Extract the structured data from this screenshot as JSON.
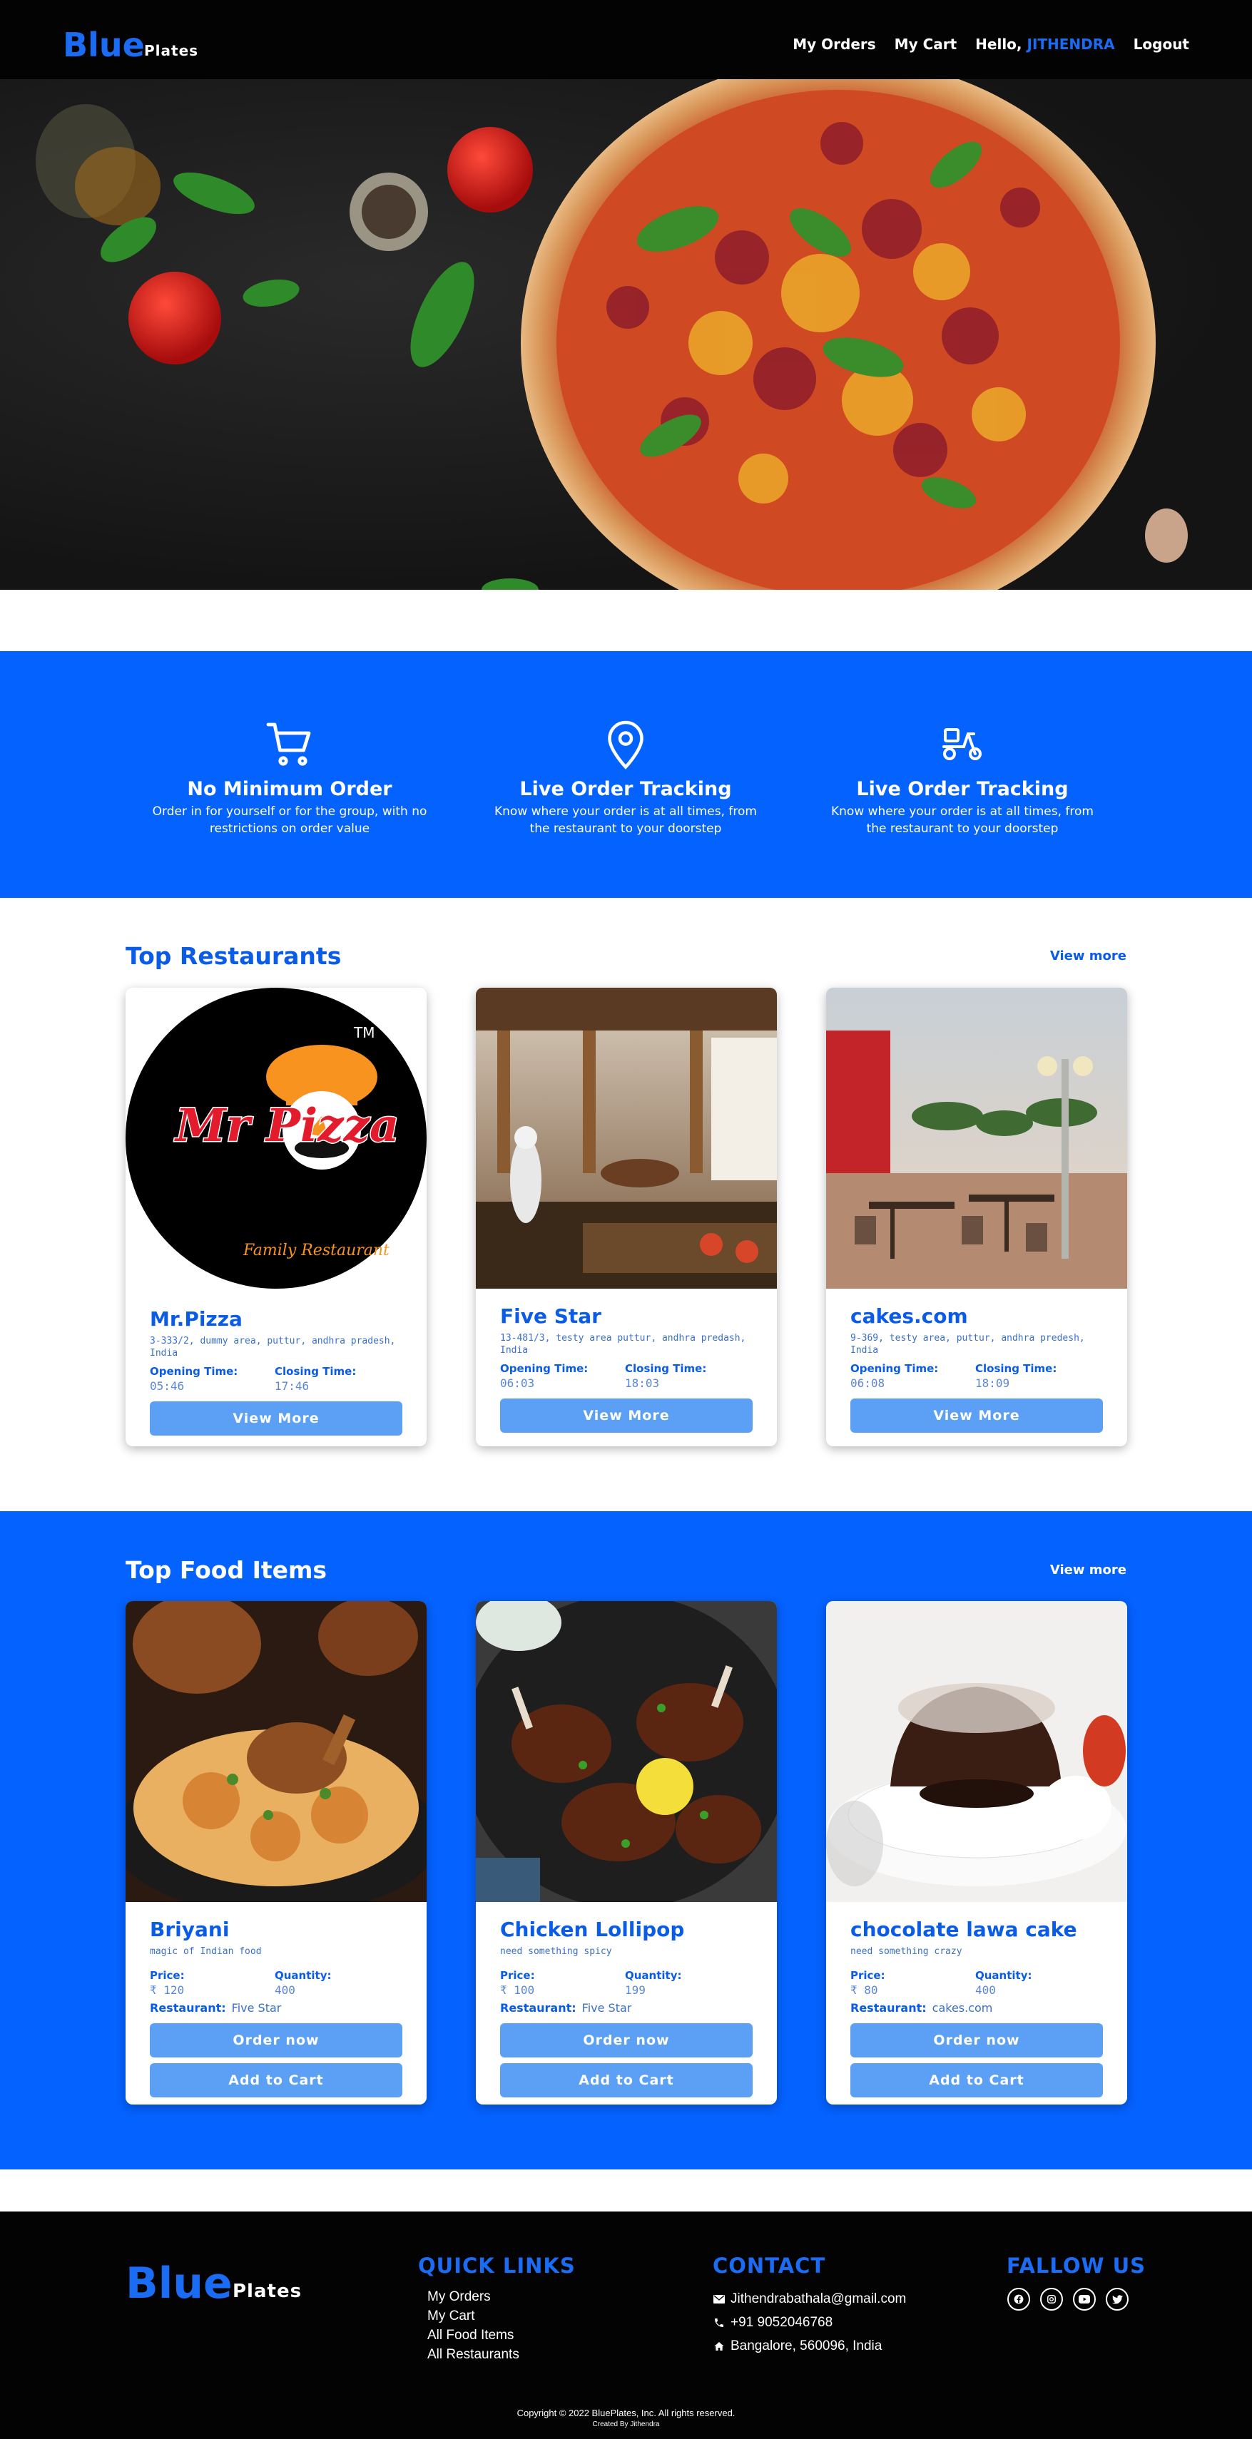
{
  "nav": {
    "logo": "Blue",
    "logo_sub": "Plates",
    "my_orders": "My Orders",
    "my_cart": "My Cart",
    "hello": "Hello,",
    "user": "JITHENDRA",
    "logout": "Logout"
  },
  "features": [
    {
      "icon": "cart-icon",
      "title": "No Minimum Order",
      "desc": "Order in for yourself or for the group, with no restrictions on order value"
    },
    {
      "icon": "location-pin-icon",
      "title": "Live Order Tracking",
      "desc": "Know where your order is at all times, from the restaurant to your doorstep"
    },
    {
      "icon": "delivery-scooter-icon",
      "title": "Live Order Tracking",
      "desc": "Know where your order is at all times, from the restaurant to your doorstep"
    }
  ],
  "restaurants": {
    "title": "Top Restaurants",
    "view_more": "View more",
    "opening_label": "Opening Time:",
    "closing_label": "Closing Time:",
    "button": "View More",
    "items": [
      {
        "name": "Mr.Pizza",
        "address": "3-333/2, dummy area, puttur, andhra pradesh, India",
        "opening": "05:46",
        "closing": "17:46",
        "logo_text": "Mr Pizza",
        "logo_sub": "Family Restaurant"
      },
      {
        "name": "Five Star",
        "address": "13-481/3, testy area puttur, andhra predash, India",
        "opening": "06:03",
        "closing": "18:03"
      },
      {
        "name": "cakes.com",
        "address": "9-369, testy area, puttur, andhra predesh, India",
        "opening": "06:08",
        "closing": "18:09"
      }
    ]
  },
  "foods": {
    "title": "Top Food Items",
    "view_more": "View more",
    "price_label": "Price:",
    "qty_label": "Quantity:",
    "rest_label": "Restaurant:",
    "order_button": "Order now",
    "cart_button": "Add to Cart",
    "items": [
      {
        "name": "Briyani",
        "tagline": "magic of Indian food",
        "price": "₹ 120",
        "quantity": "400",
        "restaurant": "Five Star"
      },
      {
        "name": "Chicken Lollipop",
        "tagline": "need something spicy",
        "price": "₹ 100",
        "quantity": "199",
        "restaurant": "Five Star"
      },
      {
        "name": "chocolate lawa cake",
        "tagline": "need something crazy",
        "price": "₹ 80",
        "quantity": "400",
        "restaurant": "cakes.com"
      }
    ]
  },
  "footer": {
    "logo": "Blue",
    "logo_sub": "Plates",
    "quick_links_title": "QUICK LINKS",
    "quick_links": [
      "My Orders",
      "My Cart",
      "All Food Items",
      "All Restaurants"
    ],
    "contact_title": "CONTACT",
    "email": "Jithendrabathala@gmail.com",
    "phone": "+91 9052046768",
    "address": "Bangalore, 560096, India",
    "follow_title": "FALLOW US",
    "social": [
      "facebook-icon",
      "instagram-icon",
      "youtube-icon",
      "twitter-icon"
    ],
    "copyright": "Copyright © 2022 BluePlates, Inc. All rights reserved.",
    "created_by": "Created By Jithendra"
  },
  "colors": {
    "brand_blue": "#0462ff",
    "logo_blue": "#1a6cf5",
    "button_blue": "#5ba0f5",
    "dark": "#030303"
  }
}
